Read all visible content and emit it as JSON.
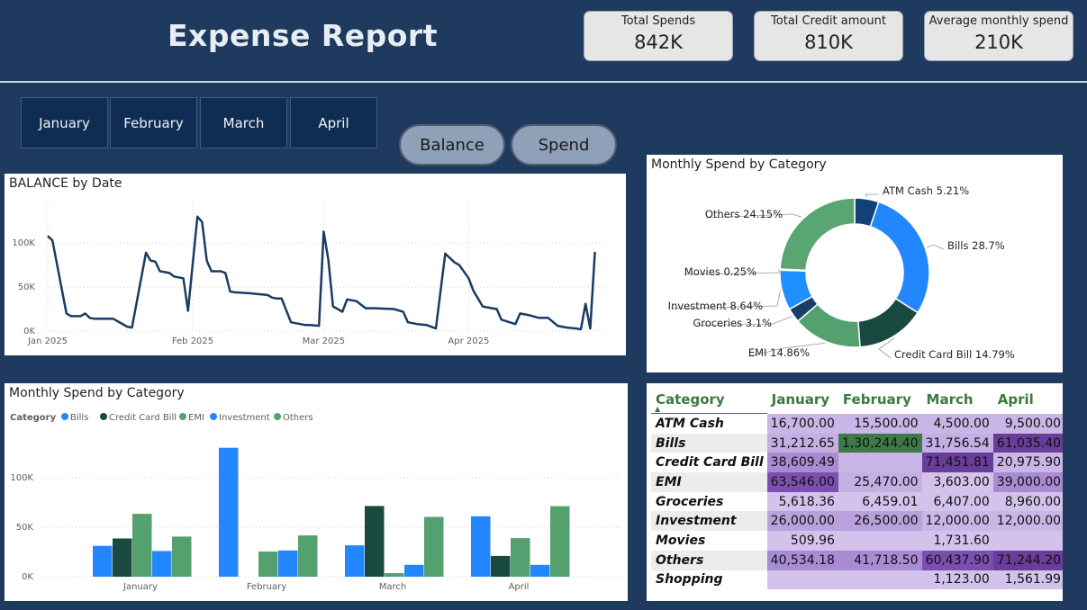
{
  "title": "Expense Report",
  "kpis": [
    {
      "label": "Total Spends",
      "value": "842K"
    },
    {
      "label": "Total Credit amount",
      "value": "810K"
    },
    {
      "label": "Average monthly spend",
      "value": "210K"
    }
  ],
  "months": [
    "January",
    "February",
    "March",
    "April"
  ],
  "toggles": [
    "Balance",
    "Spend"
  ],
  "balance_chart": {
    "title": "BALANCE by Date",
    "chart_data": {
      "type": "line",
      "title": "BALANCE by Date",
      "x_ticks": [
        "Jan 2025",
        "Feb 2025",
        "Mar 2025",
        "Apr 2025"
      ],
      "y_ticks": [
        "0K",
        "50K",
        "100K"
      ],
      "ylim": [
        0,
        140000
      ],
      "x": [
        "2025-01-01",
        "2025-01-02",
        "2025-01-05",
        "2025-01-06",
        "2025-01-07",
        "2025-01-08",
        "2025-01-09",
        "2025-01-10",
        "2025-01-11",
        "2025-01-12",
        "2025-01-13",
        "2025-01-15",
        "2025-01-18",
        "2025-01-19",
        "2025-01-22",
        "2025-01-23",
        "2025-01-24",
        "2025-01-25",
        "2025-01-26",
        "2025-01-27",
        "2025-01-28",
        "2025-01-30",
        "2025-01-31",
        "2025-02-02",
        "2025-02-03",
        "2025-02-04",
        "2025-02-05",
        "2025-02-07",
        "2025-02-08",
        "2025-02-09",
        "2025-02-10",
        "2025-02-13",
        "2025-02-15",
        "2025-02-17",
        "2025-02-18",
        "2025-02-19",
        "2025-02-20",
        "2025-02-22",
        "2025-02-25",
        "2025-02-26",
        "2025-02-28",
        "2025-03-01",
        "2025-03-02",
        "2025-03-03",
        "2025-03-04",
        "2025-03-05",
        "2025-03-06",
        "2025-03-08",
        "2025-03-10",
        "2025-03-12",
        "2025-03-16",
        "2025-03-18",
        "2025-03-19",
        "2025-03-21",
        "2025-03-23",
        "2025-03-25",
        "2025-03-27",
        "2025-03-28",
        "2025-03-29",
        "2025-03-30",
        "2025-04-01",
        "2025-04-02",
        "2025-04-04",
        "2025-04-05",
        "2025-04-06",
        "2025-04-07",
        "2025-04-08",
        "2025-04-11",
        "2025-04-12",
        "2025-04-13",
        "2025-04-14",
        "2025-04-16",
        "2025-04-18",
        "2025-04-20",
        "2025-04-22",
        "2025-04-24",
        "2025-04-25",
        "2025-04-26",
        "2025-04-27",
        "2025-04-28"
      ],
      "y": [
        108000,
        103000,
        20000,
        17000,
        17000,
        17000,
        20000,
        15000,
        14000,
        14000,
        14000,
        14000,
        5000,
        4000,
        89000,
        80000,
        79000,
        68000,
        67000,
        66000,
        62000,
        60000,
        23000,
        130000,
        124000,
        80000,
        68000,
        68000,
        66000,
        45000,
        44000,
        43000,
        42000,
        41000,
        38000,
        37000,
        37000,
        10000,
        7000,
        7000,
        6000,
        113000,
        81000,
        28000,
        25000,
        22000,
        36000,
        34000,
        26000,
        26000,
        25000,
        22000,
        10000,
        8000,
        7000,
        3000,
        88000,
        83000,
        78000,
        75000,
        60000,
        46000,
        28000,
        27000,
        26000,
        25000,
        13000,
        8000,
        20000,
        19000,
        18000,
        15000,
        15000,
        6000,
        4000,
        3000,
        2000,
        31000,
        3000,
        90000
      ]
    }
  },
  "donut_chart": {
    "title": "Monthly Spend by Category",
    "chart_data": {
      "type": "pie",
      "title": "Monthly Spend by Category",
      "slices": [
        {
          "label": "ATM Cash 5.21%",
          "value": 5.21,
          "color": "#12417a"
        },
        {
          "label": "Bills 28.7%",
          "value": 28.7,
          "color": "#2287ff"
        },
        {
          "label": "Credit Card Bill 14.79%",
          "value": 14.79,
          "color": "#1a4a3f"
        },
        {
          "label": "EMI 14.86%",
          "value": 14.86,
          "color": "#55a06f"
        },
        {
          "label": "Groceries 3.1%",
          "value": 3.1,
          "color": "#1a3e6a"
        },
        {
          "label": "Investment 8.64%",
          "value": 8.64,
          "color": "#1f8fff"
        },
        {
          "label": "Movies 0.25%",
          "value": 0.25,
          "color": "#1c8a5c"
        },
        {
          "label": "Others 24.15%",
          "value": 24.15,
          "color": "#5aa673"
        }
      ]
    }
  },
  "bar_chart": {
    "title": "Monthly Spend by Category",
    "legend_title": "Category",
    "chart_data": {
      "type": "bar",
      "title": "Monthly Spend by Category",
      "categories": [
        "January",
        "February",
        "March",
        "April"
      ],
      "y_ticks": [
        "0K",
        "50K",
        "100K"
      ],
      "ylim": [
        0,
        150000
      ],
      "series": [
        {
          "name": "Bills",
          "color": "#2287ff",
          "values": [
            31212.65,
            130244.4,
            31756.54,
            61035.4
          ]
        },
        {
          "name": "Credit Card Bill",
          "color": "#1a4a3f",
          "values": [
            38609.49,
            0,
            71451.81,
            20975.9
          ]
        },
        {
          "name": "EMI",
          "color": "#55a06f",
          "values": [
            63546.0,
            25470.0,
            3603.0,
            39000.0
          ]
        },
        {
          "name": "Investment",
          "color": "#2287ff",
          "values": [
            26000.0,
            26500.0,
            12000.0,
            12000.0
          ]
        },
        {
          "name": "Others",
          "color": "#55a06f",
          "values": [
            40534.18,
            41718.5,
            60437.9,
            71244.2
          ]
        }
      ]
    }
  },
  "matrix": {
    "headers": [
      "Category",
      "January",
      "February",
      "March",
      "April"
    ],
    "rows": [
      {
        "cat": "ATM Cash",
        "vals": [
          "16,700.00",
          "15,500.00",
          "4,500.00",
          "9,500.00"
        ],
        "bg": [
          "#c9b5e6",
          "#c9b5e6",
          "#c9b5e6",
          "#c9b5e6"
        ]
      },
      {
        "cat": "Bills",
        "vals": [
          "31,212.65",
          "1,30,244.40",
          "31,756.54",
          "61,035.40"
        ],
        "bg": [
          "#c4aee3",
          "#3d7a46",
          "#c4aee3",
          "#6a3d9a"
        ]
      },
      {
        "cat": "Credit Card Bill",
        "vals": [
          "38,609.49",
          "",
          "71,451.81",
          "20,975.90"
        ],
        "bg": [
          "#a98bd4",
          "#c9b5e6",
          "#6a3d9a",
          "#c9b5e6"
        ]
      },
      {
        "cat": "EMI",
        "vals": [
          "63,546.00",
          "25,470.00",
          "3,603.00",
          "39,000.00"
        ],
        "bg": [
          "#7b4fb0",
          "#c4aee3",
          "#d3c3ec",
          "#a98bd4"
        ]
      },
      {
        "cat": "Groceries",
        "vals": [
          "5,618.36",
          "6,459.01",
          "6,407.00",
          "8,960.00"
        ],
        "bg": [
          "#d3c3ec",
          "#d3c3ec",
          "#d3c3ec",
          "#d3c3ec"
        ]
      },
      {
        "cat": "Investment",
        "vals": [
          "26,000.00",
          "26,500.00",
          "12,000.00",
          "12,000.00"
        ],
        "bg": [
          "#b9a1de",
          "#b9a1de",
          "#c9b5e6",
          "#c9b5e6"
        ]
      },
      {
        "cat": "Movies",
        "vals": [
          "509.96",
          "",
          "1,731.60",
          ""
        ],
        "bg": [
          "#d3c3ec",
          "#d3c3ec",
          "#d3c3ec",
          "#d3c3ec"
        ]
      },
      {
        "cat": "Others",
        "vals": [
          "40,534.18",
          "41,718.50",
          "60,437.90",
          "71,244.20"
        ],
        "bg": [
          "#a98bd4",
          "#a98bd4",
          "#7b4fb0",
          "#6a3d9a"
        ]
      },
      {
        "cat": "Shopping",
        "vals": [
          "",
          "",
          "1,123.00",
          "1,561.99"
        ],
        "bg": [
          "#d3c3ec",
          "#d3c3ec",
          "#d3c3ec",
          "#d3c3ec"
        ]
      }
    ]
  },
  "colors": {
    "background": "#1e3a5f",
    "line": "#1a3b63"
  }
}
